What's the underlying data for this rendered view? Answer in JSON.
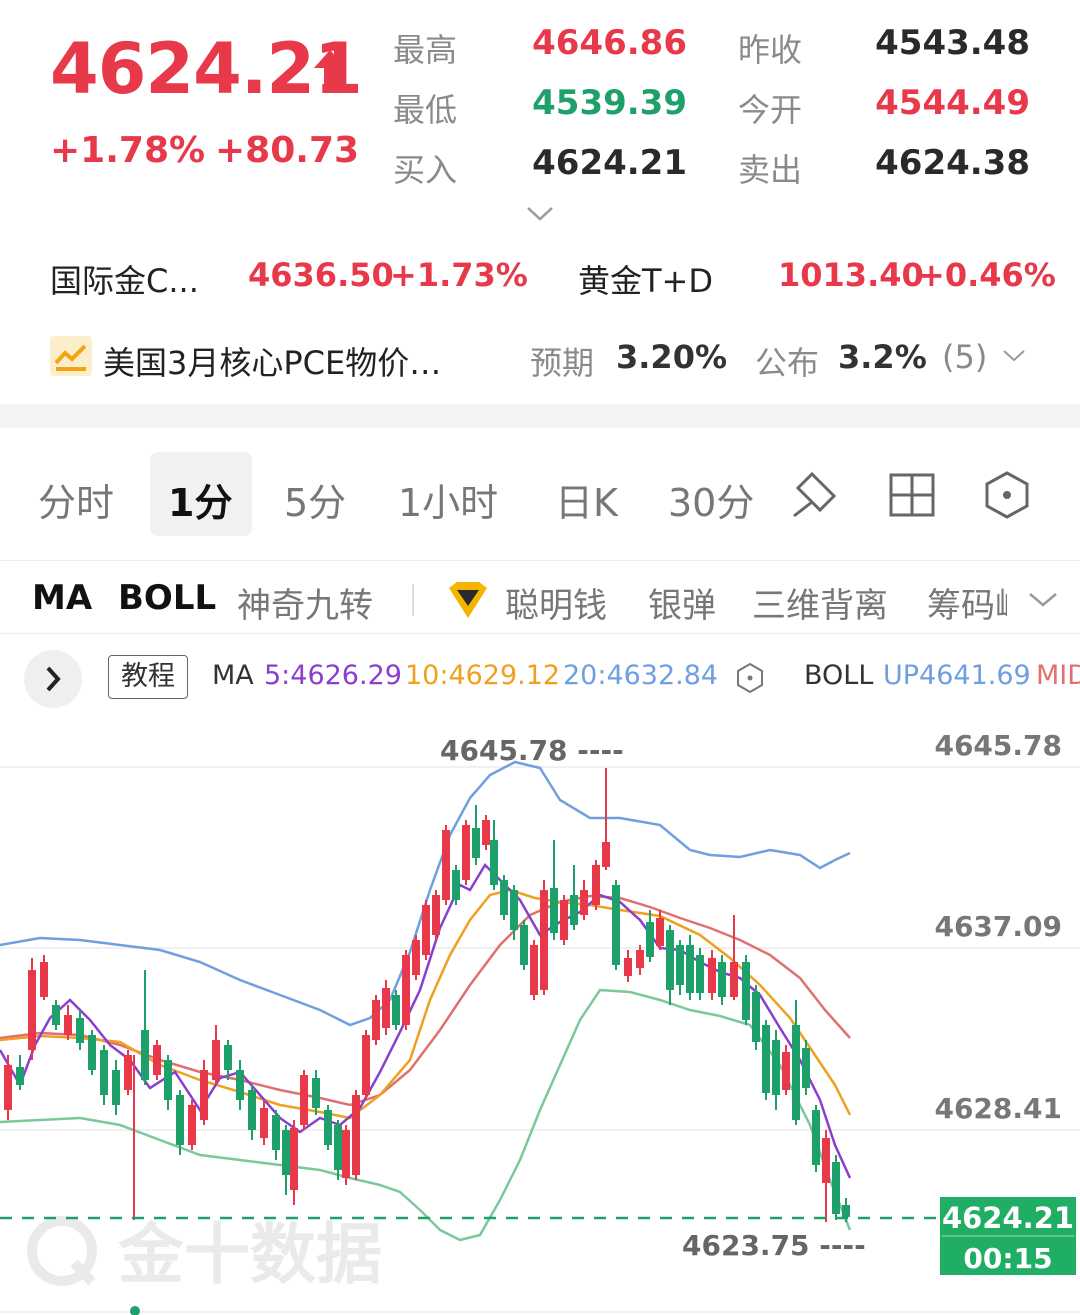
{
  "quote": {
    "price": "4624.21",
    "change_pct": "+1.78%",
    "change_abs": "+80.73",
    "high_label": "最高",
    "high_value": "4646.86",
    "low_label": "最低",
    "low_value": "4539.39",
    "bid_label": "买入",
    "bid_value": "4624.21",
    "prev_close_label": "昨收",
    "prev_close_value": "4543.48",
    "open_label": "今开",
    "open_value": "4544.49",
    "ask_label": "卖出",
    "ask_value": "4624.38"
  },
  "related": [
    {
      "name": "国际金C...",
      "price": "4636.50",
      "change": "+1.73%"
    },
    {
      "name": "黄金T+D",
      "price": "1013.40",
      "change": "+0.46%"
    }
  ],
  "news": {
    "title": "美国3月核心PCE物价…",
    "expected_label": "预期",
    "expected_value": "3.20%",
    "actual_label": "公布",
    "actual_value": "3.2%",
    "count": "(5)"
  },
  "tabs": [
    "分时",
    "1分",
    "5分",
    "1小时",
    "日K",
    "30分"
  ],
  "active_tab": "1分",
  "indicators": [
    "MA",
    "BOLL",
    "神奇九转",
    "聪明钱",
    "银弹",
    "三维背离",
    "筹码峰"
  ],
  "ma_row": {
    "tutorial": "教程",
    "ma_label": "MA",
    "ma5": "5:4626.29",
    "ma10": "10:4629.12",
    "ma20": "20:4632.84",
    "boll_label": "BOLL",
    "boll_up": "UP4641.69",
    "boll_mid": "MID"
  },
  "chart": {
    "axis_labels": [
      "4645.78",
      "4637.09",
      "4628.41"
    ],
    "high_marker": "4645.78 ----",
    "low_marker": "4623.75 ----",
    "last_price": "4624.21",
    "countdown": "00:15",
    "watermark": "金十数据"
  },
  "colors": {
    "up": "#e8394a",
    "down": "#1ea06a",
    "ma5": "#8a3fd0",
    "ma10": "#f0a020",
    "ma20": "#e07070",
    "boll_up": "#6f9fe0",
    "boll_low": "#7cc89a"
  }
}
